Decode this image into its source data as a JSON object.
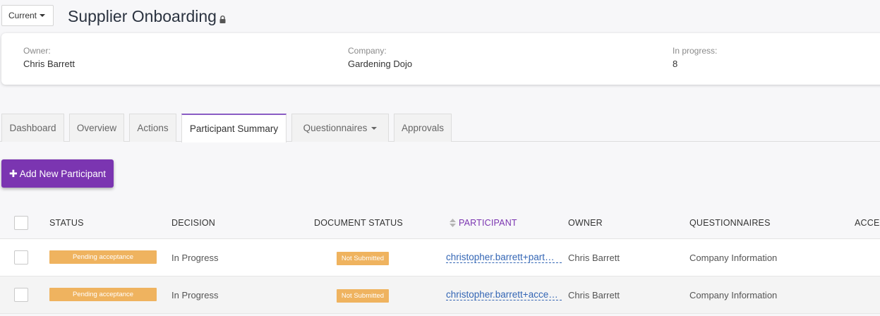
{
  "header": {
    "version_selector": "Current",
    "title": "Supplier Onboarding"
  },
  "info": {
    "owner_label": "Owner:",
    "owner_value": "Chris Barrett",
    "company_label": "Company:",
    "company_value": "Gardening Dojo",
    "status_label": "In progress:",
    "status_value": "8"
  },
  "tabs": [
    {
      "label": "Dashboard"
    },
    {
      "label": "Overview"
    },
    {
      "label": "Actions"
    },
    {
      "label": "Participant Summary",
      "active": true
    },
    {
      "label": "Questionnaires"
    },
    {
      "label": "Approvals"
    }
  ],
  "actions": {
    "add_participant": "Add New Participant"
  },
  "table": {
    "columns": [
      "STATUS",
      "DECISION",
      "DOCUMENT STATUS",
      "PARTICIPANT",
      "OWNER",
      "QUESTIONNAIRES",
      "ACCE"
    ],
    "rows": [
      {
        "status": "Pending acceptance",
        "decision": "In Progress",
        "document_status": "Not Submitted",
        "participant": "christopher.barrett+part…",
        "owner": "Chris Barrett",
        "questionnaires": "Company Information"
      },
      {
        "status": "Pending acceptance",
        "decision": "In Progress",
        "document_status": "Not Submitted",
        "participant": "christopher.barrett+acce…",
        "owner": "Chris Barrett",
        "questionnaires": "Company Information"
      }
    ]
  },
  "colors": {
    "accent_purple": "#7b35b1",
    "badge_orange": "#efb35f",
    "link_blue": "#3466b5",
    "title": "#2b3340"
  }
}
